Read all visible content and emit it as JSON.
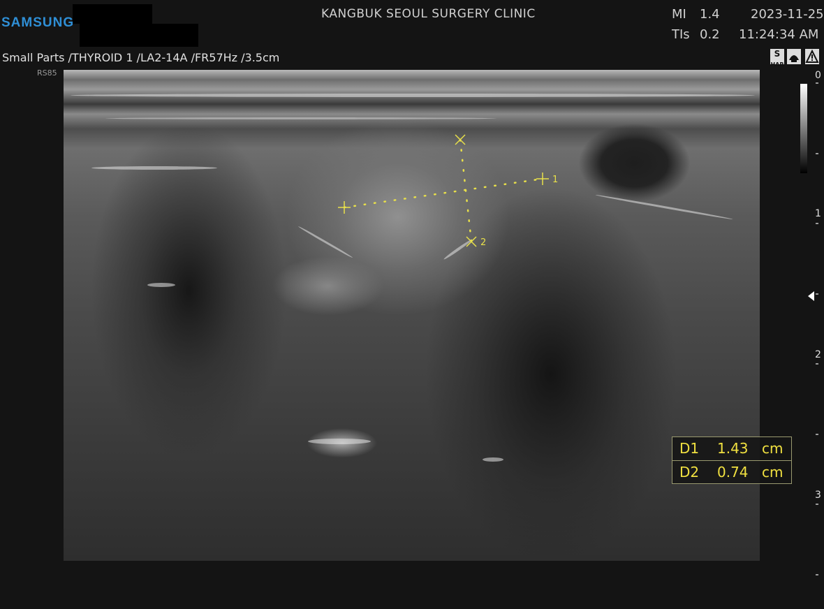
{
  "header": {
    "brand": "SAMSUNG",
    "clinic": "KANGBUK SEOUL SURGERY CLINIC",
    "mi_label": "MI",
    "mi_value": "1.4",
    "tis_label": "TIs",
    "tis_value": "0.2",
    "date": "2023-11-25",
    "time": "11:24:34 AM"
  },
  "preset": "Small Parts /THYROID 1 /LA2-14A /FR57Hz /3.5cm",
  "probe_label": "RS85",
  "status_icons": [
    {
      "name": "harmonic-icon",
      "text": "S",
      "subtext": "HAR"
    },
    {
      "name": "probe-orientation-icon"
    },
    {
      "name": "warning-icon"
    }
  ],
  "measurements": [
    {
      "label": "D1",
      "value": "1.43",
      "unit": "cm"
    },
    {
      "label": "D2",
      "value": "0.74",
      "unit": "cm"
    }
  ],
  "caliper_labels": [
    "1",
    "2"
  ],
  "depth_scale": {
    "labels": [
      "0",
      "1",
      "2",
      "3"
    ]
  },
  "colors": {
    "brand": "#2f8fd6",
    "measurement": "#f0e040"
  }
}
